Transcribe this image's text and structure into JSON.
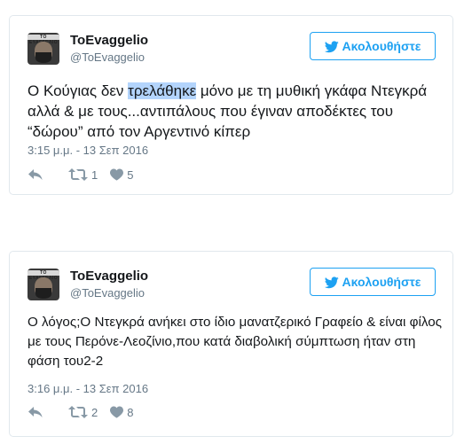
{
  "tweets": [
    {
      "author_name": "ToEvaggelio",
      "author_handle": "@ToEvaggelio",
      "avatar_label": "TO ΕΥΑΓΓΕΛΙΟ",
      "follow_label": "Ακολουθήστε",
      "text_before": "Ο Κούγιας δεν ",
      "text_highlight": "τρελάθηκε",
      "text_after": " μόνο με τη μυθική γκάφα Ντεγκρά αλλά & με τους...αντιπάλους που έγιναν αποδέκτες του “δώρου” από τον Αργεντινό κίπερ",
      "timestamp": "3:15 μ.μ. - 13 Σεπ 2016",
      "retweets": "1",
      "likes": "5"
    },
    {
      "author_name": "ToEvaggelio",
      "author_handle": "@ToEvaggelio",
      "avatar_label": "TO ΕΥΑΓΓΕΛΙΟ",
      "follow_label": "Ακολουθήστε",
      "text": "Ο λόγος;Ο Ντεγκρά ανήκει στο ίδιο μανατζερικό Γραφείο & είναι φίλος με τους Περόνε-Λεοζίνιο,που κατά διαβολική σύμπτωση ήταν στη φάση του2-2",
      "timestamp": "3:16 μ.μ. - 13 Σεπ 2016",
      "retweets": "2",
      "likes": "8"
    }
  ],
  "colors": {
    "accent": "#1da1f2",
    "border": "#e1e8ed",
    "secondary_text": "#657786",
    "icon": "#8899a6",
    "selection": "#b3d4fc"
  },
  "icons": [
    "bird-icon",
    "reply-icon",
    "retweet-icon",
    "heart-icon"
  ]
}
